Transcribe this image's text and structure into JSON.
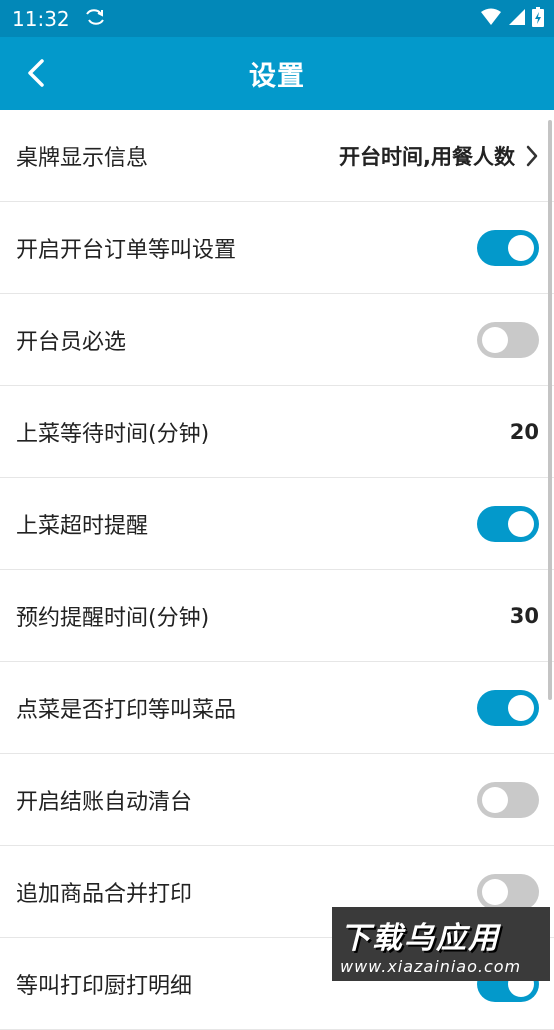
{
  "status_bar": {
    "time": "11:32"
  },
  "app_bar": {
    "title": "设置"
  },
  "settings": [
    {
      "label": "桌牌显示信息",
      "type": "link",
      "value": "开台时间,用餐人数"
    },
    {
      "label": "开启开台订单等叫设置",
      "type": "toggle",
      "on": true
    },
    {
      "label": "开台员必选",
      "type": "toggle",
      "on": false
    },
    {
      "label": "上菜等待时间(分钟)",
      "type": "value",
      "value": "20"
    },
    {
      "label": "上菜超时提醒",
      "type": "toggle",
      "on": true
    },
    {
      "label": "预约提醒时间(分钟)",
      "type": "value",
      "value": "30"
    },
    {
      "label": "点菜是否打印等叫菜品",
      "type": "toggle",
      "on": true
    },
    {
      "label": "开启结账自动清台",
      "type": "toggle",
      "on": false
    },
    {
      "label": "追加商品合并打印",
      "type": "toggle",
      "on": false
    },
    {
      "label": "等叫打印厨打明细",
      "type": "toggle",
      "on": true
    }
  ],
  "watermark": {
    "main": "下载乌应用",
    "sub": "www.xiazainiao.com"
  },
  "colors": {
    "primary": "#0399cb",
    "status_bar": "#0288b8",
    "toggle_off": "#c9c9c9"
  }
}
